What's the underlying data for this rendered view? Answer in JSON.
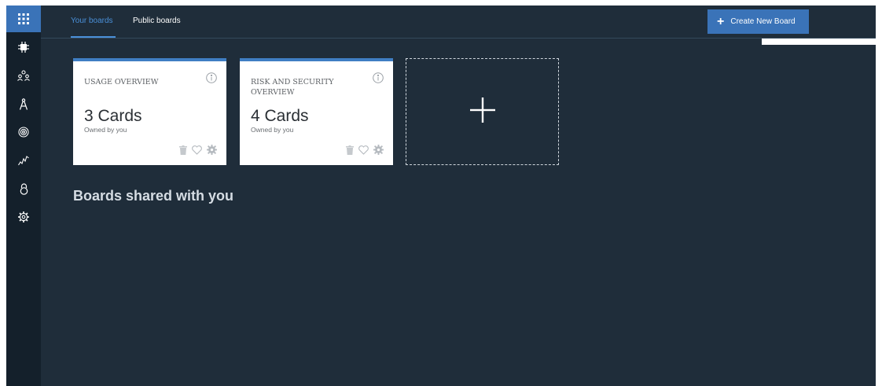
{
  "topbar": {
    "tabs": [
      {
        "label": "Your boards",
        "active": true
      },
      {
        "label": "Public boards",
        "active": false
      }
    ],
    "create_button_label": "Create New Board"
  },
  "sidebar": {
    "items": [
      {
        "icon": "apps-grid-icon",
        "active": true
      },
      {
        "icon": "chip-icon"
      },
      {
        "icon": "users-icon"
      },
      {
        "icon": "compass-icon"
      },
      {
        "icon": "badge-icon"
      },
      {
        "icon": "activity-chart-icon"
      },
      {
        "icon": "lock-icon"
      },
      {
        "icon": "settings-icon"
      }
    ]
  },
  "boards": [
    {
      "title": "USAGE OVERVIEW",
      "count": "3 Cards",
      "owner": "Owned by you"
    },
    {
      "title": "RISK AND SECURITY OVERVIEW",
      "count": "4 Cards",
      "owner": "Owned by you"
    }
  ],
  "shared_heading": "Boards shared with you",
  "colors": {
    "background": "#1f2d3a",
    "rail": "#14202b",
    "accent": "#3a73b8",
    "link_active": "#4a90d9"
  }
}
